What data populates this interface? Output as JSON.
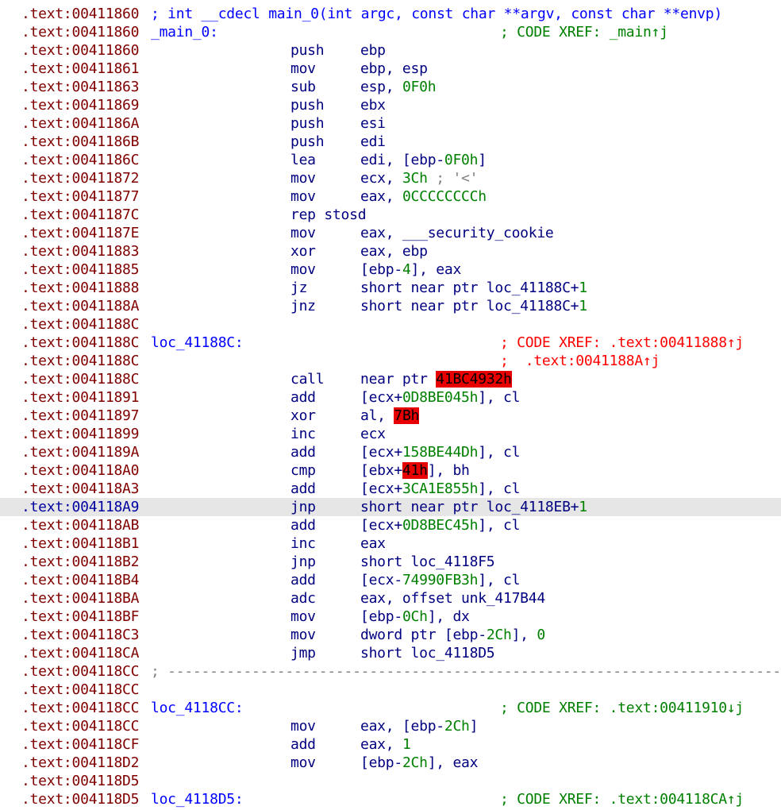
{
  "colors": {
    "address": "#800000",
    "address_selected": "#0000a0",
    "instruction": "#000080",
    "number": "#008000",
    "xref_comment": "#ff0000",
    "label": "#0000ff",
    "error_highlight": "#e80000",
    "selected_line_bg": "#e6e6e6"
  },
  "lines": [
    {
      "addr": ".text:00411860",
      "header": "; int __cdecl main_0(int argc, const char **argv, const char **envp)"
    },
    {
      "addr": ".text:00411860",
      "label": "_main_0:",
      "comment": "; CODE XREF: _main↑j",
      "comment_color": "green"
    },
    {
      "addr": ".text:00411860",
      "mnem": "push",
      "ops": [
        {
          "t": "ebp"
        }
      ]
    },
    {
      "addr": ".text:00411861",
      "mnem": "mov",
      "ops": [
        {
          "t": "ebp, esp"
        }
      ]
    },
    {
      "addr": ".text:00411863",
      "mnem": "sub",
      "ops": [
        {
          "t": "esp, "
        },
        {
          "t": "0F0h",
          "k": "n"
        }
      ]
    },
    {
      "addr": ".text:00411869",
      "mnem": "push",
      "ops": [
        {
          "t": "ebx"
        }
      ]
    },
    {
      "addr": ".text:0041186A",
      "mnem": "push",
      "ops": [
        {
          "t": "esi"
        }
      ]
    },
    {
      "addr": ".text:0041186B",
      "mnem": "push",
      "ops": [
        {
          "t": "edi"
        }
      ]
    },
    {
      "addr": ".text:0041186C",
      "mnem": "lea",
      "ops": [
        {
          "t": "edi, [ebp-"
        },
        {
          "t": "0F0h",
          "k": "n"
        },
        {
          "t": "]"
        }
      ]
    },
    {
      "addr": ".text:00411872",
      "mnem": "mov",
      "ops": [
        {
          "t": "ecx, "
        },
        {
          "t": "3Ch",
          "k": "n"
        },
        {
          "t": " ; '<'",
          "k": "gray"
        }
      ]
    },
    {
      "addr": ".text:00411877",
      "mnem": "mov",
      "ops": [
        {
          "t": "eax, "
        },
        {
          "t": "0CCCCCCCCh",
          "k": "n"
        }
      ]
    },
    {
      "addr": ".text:0041187C",
      "mnem": "rep stosd",
      "ops": []
    },
    {
      "addr": ".text:0041187E",
      "mnem": "mov",
      "ops": [
        {
          "t": "eax, ___security_cookie"
        }
      ]
    },
    {
      "addr": ".text:00411883",
      "mnem": "xor",
      "ops": [
        {
          "t": "eax, ebp"
        }
      ]
    },
    {
      "addr": ".text:00411885",
      "mnem": "mov",
      "ops": [
        {
          "t": "[ebp-"
        },
        {
          "t": "4",
          "k": "n"
        },
        {
          "t": "], eax"
        }
      ]
    },
    {
      "addr": ".text:00411888",
      "mnem": "jz",
      "ops": [
        {
          "t": "short near ptr loc_41188C+"
        },
        {
          "t": "1",
          "k": "n"
        }
      ]
    },
    {
      "addr": ".text:0041188A",
      "mnem": "jnz",
      "ops": [
        {
          "t": "short near ptr loc_41188C+"
        },
        {
          "t": "1",
          "k": "n"
        }
      ]
    },
    {
      "addr": ".text:0041188C"
    },
    {
      "addr": ".text:0041188C",
      "label": "loc_41188C:",
      "comment": "; CODE XREF: .text:00411888↑j"
    },
    {
      "addr": ".text:0041188C",
      "comment": ";  .text:0041188A↑j"
    },
    {
      "addr": ".text:0041188C",
      "mnem": "call",
      "ops": [
        {
          "t": "near ptr "
        },
        {
          "t": "41BC4932h",
          "k": "red"
        }
      ]
    },
    {
      "addr": ".text:00411891",
      "mnem": "add",
      "ops": [
        {
          "t": "[ecx+"
        },
        {
          "t": "0D8BE045h",
          "k": "n"
        },
        {
          "t": "], cl"
        }
      ]
    },
    {
      "addr": ".text:00411897",
      "mnem": "xor",
      "ops": [
        {
          "t": "al, "
        },
        {
          "t": "7Bh",
          "k": "red"
        }
      ]
    },
    {
      "addr": ".text:00411899",
      "mnem": "inc",
      "ops": [
        {
          "t": "ecx"
        }
      ]
    },
    {
      "addr": ".text:0041189A",
      "mnem": "add",
      "ops": [
        {
          "t": "[ecx+"
        },
        {
          "t": "158BE44Dh",
          "k": "n"
        },
        {
          "t": "], cl"
        }
      ]
    },
    {
      "addr": ".text:004118A0",
      "mnem": "cmp",
      "ops": [
        {
          "t": "[ebx+"
        },
        {
          "t": "41h",
          "k": "red"
        },
        {
          "t": "], bh"
        }
      ]
    },
    {
      "addr": ".text:004118A3",
      "mnem": "add",
      "ops": [
        {
          "t": "[ecx+"
        },
        {
          "t": "3CA1E855h",
          "k": "n"
        },
        {
          "t": "], cl"
        }
      ]
    },
    {
      "addr": ".text:004118A9",
      "selected": true,
      "mnem": "jnp",
      "ops": [
        {
          "t": "short near ptr loc_4118EB+"
        },
        {
          "t": "1",
          "k": "n"
        }
      ]
    },
    {
      "addr": ".text:004118AB",
      "mnem": "add",
      "ops": [
        {
          "t": "[ecx+"
        },
        {
          "t": "0D8BEC45h",
          "k": "n"
        },
        {
          "t": "], cl"
        }
      ]
    },
    {
      "addr": ".text:004118B1",
      "mnem": "inc",
      "ops": [
        {
          "t": "eax"
        }
      ]
    },
    {
      "addr": ".text:004118B2",
      "mnem": "jnp",
      "ops": [
        {
          "t": "short loc_4118F5"
        }
      ]
    },
    {
      "addr": ".text:004118B4",
      "mnem": "add",
      "ops": [
        {
          "t": "[ecx-"
        },
        {
          "t": "74990FB3h",
          "k": "n"
        },
        {
          "t": "], cl"
        }
      ]
    },
    {
      "addr": ".text:004118BA",
      "mnem": "adc",
      "ops": [
        {
          "t": "eax, offset unk_417B44"
        }
      ]
    },
    {
      "addr": ".text:004118BF",
      "mnem": "mov",
      "ops": [
        {
          "t": "[ebp-"
        },
        {
          "t": "0Ch",
          "k": "n"
        },
        {
          "t": "], dx"
        }
      ]
    },
    {
      "addr": ".text:004118C3",
      "mnem": "mov",
      "ops": [
        {
          "t": "dword ptr [ebp-"
        },
        {
          "t": "2Ch",
          "k": "n"
        },
        {
          "t": "], "
        },
        {
          "t": "0",
          "k": "n"
        }
      ]
    },
    {
      "addr": ".text:004118CA",
      "mnem": "jmp",
      "ops": [
        {
          "t": "short loc_4118D5"
        }
      ]
    },
    {
      "addr": ".text:004118CC",
      "separator": "; ---------------------------------------------------------------------------"
    },
    {
      "addr": ".text:004118CC"
    },
    {
      "addr": ".text:004118CC",
      "label": "loc_4118CC:",
      "comment": "; CODE XREF: .text:00411910↓j",
      "comment_color": "green"
    },
    {
      "addr": ".text:004118CC",
      "mnem": "mov",
      "ops": [
        {
          "t": "eax, [ebp-"
        },
        {
          "t": "2Ch",
          "k": "n"
        },
        {
          "t": "]"
        }
      ]
    },
    {
      "addr": ".text:004118CF",
      "mnem": "add",
      "ops": [
        {
          "t": "eax, "
        },
        {
          "t": "1",
          "k": "n"
        }
      ]
    },
    {
      "addr": ".text:004118D2",
      "mnem": "mov",
      "ops": [
        {
          "t": "[ebp-"
        },
        {
          "t": "2Ch",
          "k": "n"
        },
        {
          "t": "], eax"
        }
      ]
    },
    {
      "addr": ".text:004118D5"
    },
    {
      "addr": ".text:004118D5",
      "label": "loc_4118D5:",
      "comment": "; CODE XREF: .text:004118CA↑j",
      "comment_color": "green"
    }
  ]
}
